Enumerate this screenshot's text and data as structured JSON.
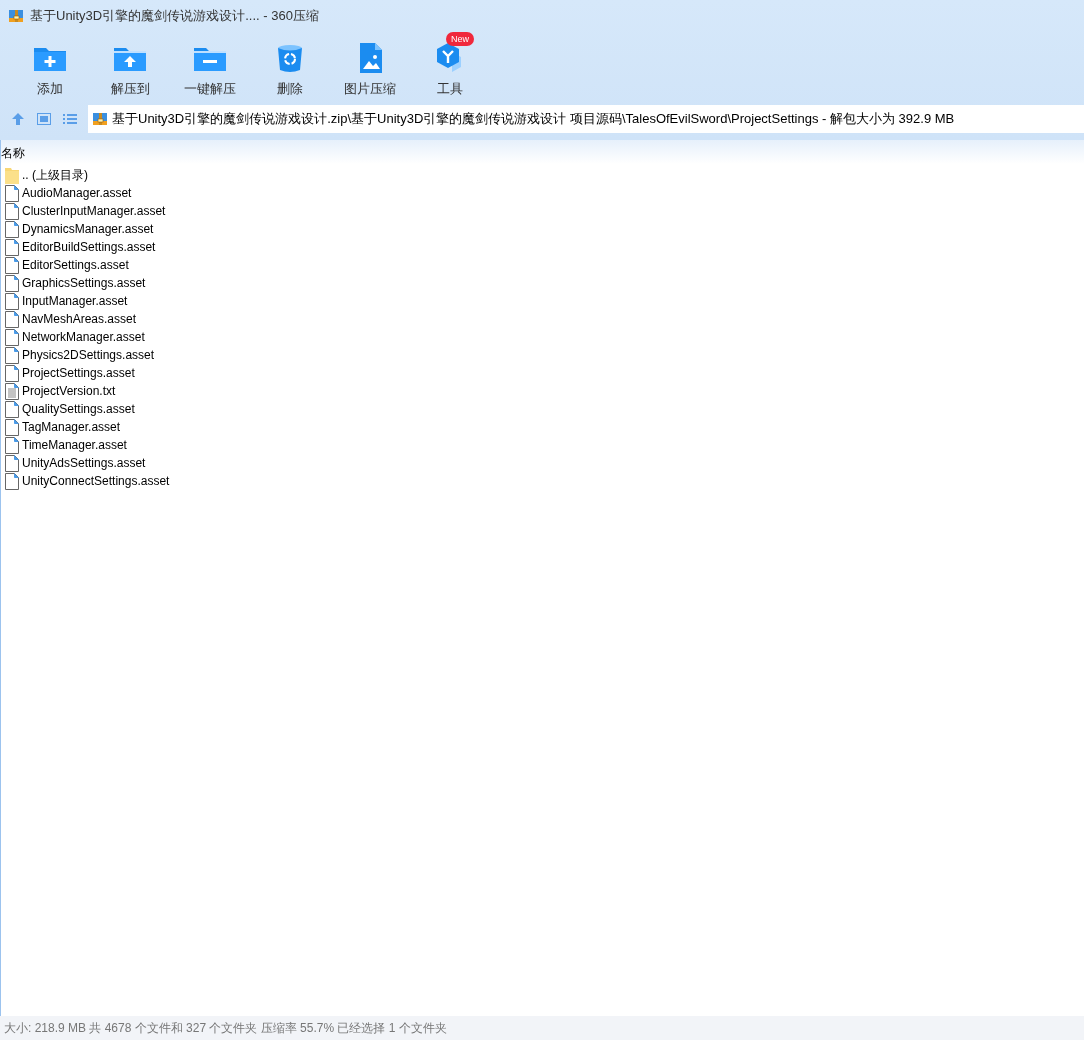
{
  "window": {
    "title": "基于Unity3D引擎的魔剑传说游戏设计.... - 360压缩"
  },
  "toolbar": [
    {
      "label": "添加",
      "kind": "add"
    },
    {
      "label": "解压到",
      "kind": "extract"
    },
    {
      "label": "一键解压",
      "kind": "oneclick"
    },
    {
      "label": "删除",
      "kind": "delete"
    },
    {
      "label": "图片压缩",
      "kind": "image"
    },
    {
      "label": "工具",
      "kind": "tools",
      "badge": "New"
    }
  ],
  "address": {
    "path": "基于Unity3D引擎的魔剑传说游戏设计.zip\\基于Unity3D引擎的魔剑传说游戏设计 项目源码\\TalesOfEvilSword\\ProjectSettings - 解包大小为 392.9 MB"
  },
  "table": {
    "columns": [
      "名称"
    ],
    "rows": [
      {
        "name": ".. (上级目录)",
        "kind": "folder"
      },
      {
        "name": "AudioManager.asset",
        "kind": "file"
      },
      {
        "name": "ClusterInputManager.asset",
        "kind": "file"
      },
      {
        "name": "DynamicsManager.asset",
        "kind": "file"
      },
      {
        "name": "EditorBuildSettings.asset",
        "kind": "file"
      },
      {
        "name": "EditorSettings.asset",
        "kind": "file"
      },
      {
        "name": "GraphicsSettings.asset",
        "kind": "file"
      },
      {
        "name": "InputManager.asset",
        "kind": "file"
      },
      {
        "name": "NavMeshAreas.asset",
        "kind": "file"
      },
      {
        "name": "NetworkManager.asset",
        "kind": "file"
      },
      {
        "name": "Physics2DSettings.asset",
        "kind": "file"
      },
      {
        "name": "ProjectSettings.asset",
        "kind": "file"
      },
      {
        "name": "ProjectVersion.txt",
        "kind": "text"
      },
      {
        "name": "QualitySettings.asset",
        "kind": "file"
      },
      {
        "name": "TagManager.asset",
        "kind": "file"
      },
      {
        "name": "TimeManager.asset",
        "kind": "file"
      },
      {
        "name": "UnityAdsSettings.asset",
        "kind": "file"
      },
      {
        "name": "UnityConnectSettings.asset",
        "kind": "file"
      }
    ]
  },
  "status_bar": "大小: 218.9 MB 共 4678 个文件和 327 个文件夹 压缩率 55.7% 已经选择 1 个文件夹"
}
